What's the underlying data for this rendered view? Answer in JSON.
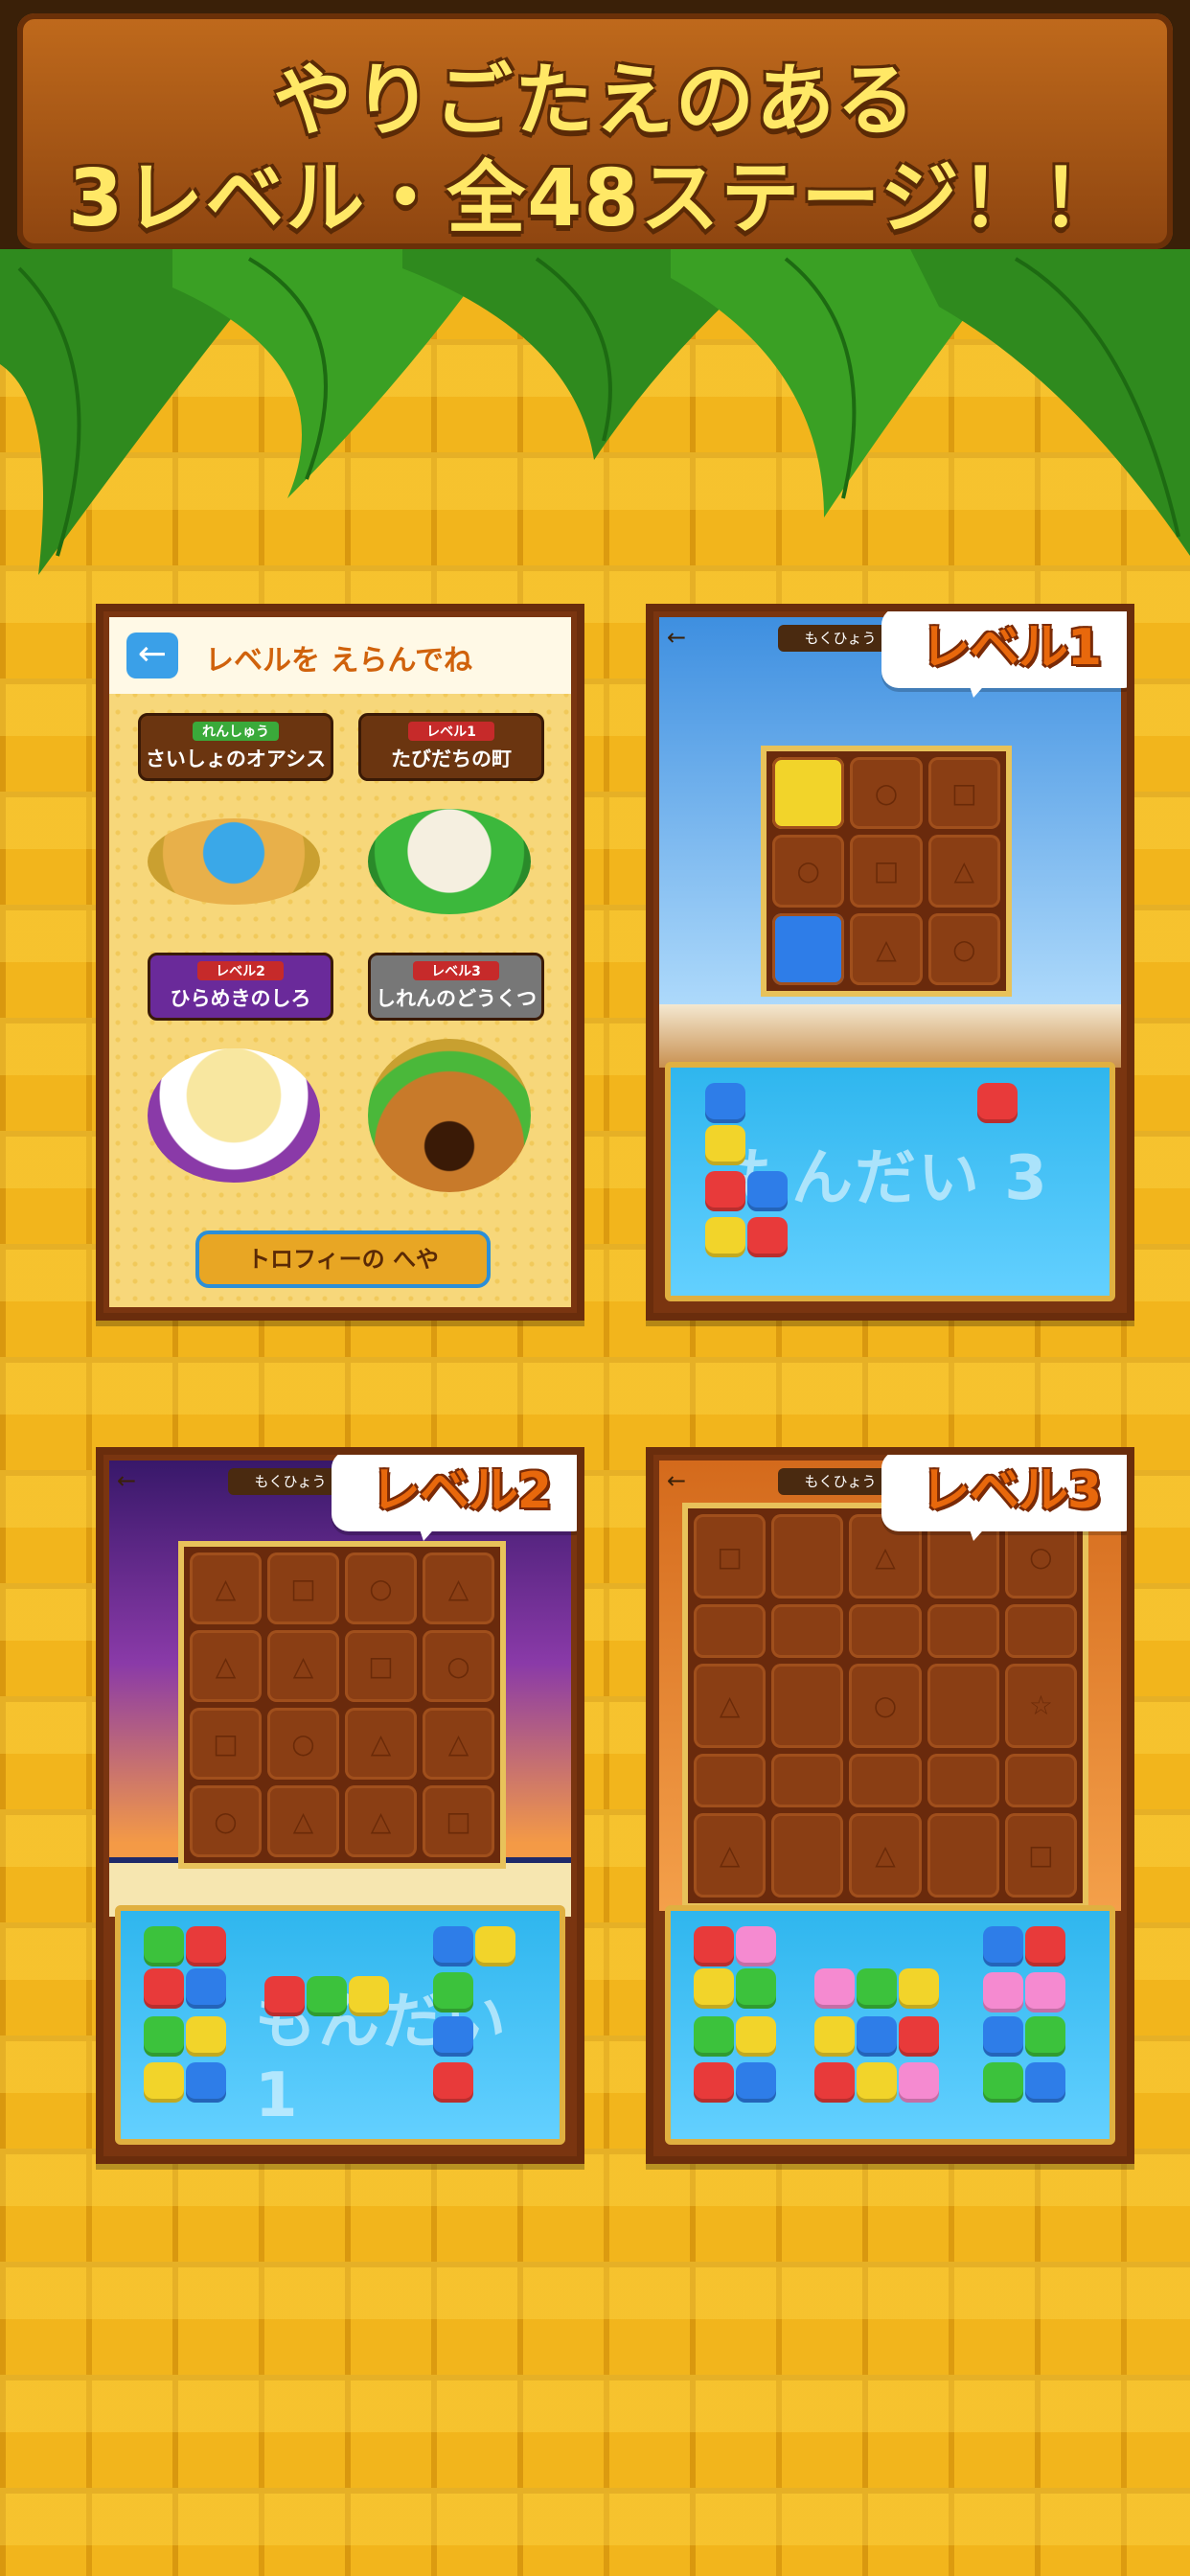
{
  "header": {
    "line1": "やりごたえのある",
    "line2": "3レベル・全48ステージ！！"
  },
  "level_select": {
    "title": "レベルを えらんでね",
    "areas": [
      {
        "tag": "れんしゅう",
        "name": "さいしょのオアシス"
      },
      {
        "tag": "レベル1",
        "name": "たびだちの町"
      },
      {
        "tag": "レベル2",
        "name": "ひらめきのしろ"
      },
      {
        "tag": "レベル3",
        "name": "しれんのどうくつ"
      }
    ],
    "trophy_button": "トロフィーの へや"
  },
  "screens": [
    {
      "level_label": "レベル1",
      "goal": "もくひょう",
      "tray_text": "もんだい 3"
    },
    {
      "level_label": "レベル2",
      "goal": "もくひょう",
      "tray_text": "もんだい 1"
    },
    {
      "level_label": "レベル3",
      "goal": "もくひょう",
      "tray_text": ""
    }
  ],
  "colors": {
    "brick": "#f2b51c",
    "mortar": "#d9980f",
    "banner": "#8e4510",
    "title_text": "#ffe866",
    "bubble_text": "#e8680c"
  }
}
